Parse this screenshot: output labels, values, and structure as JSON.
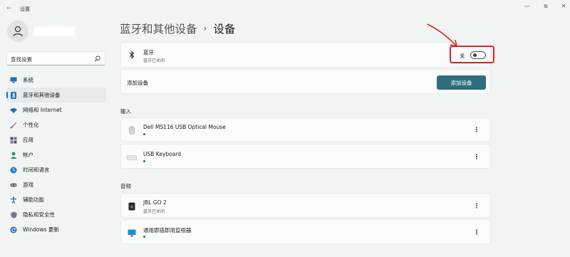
{
  "window": {
    "back_glyph": "←",
    "title": "设置",
    "minimize_glyph": "—",
    "maximize_glyph": "⧉",
    "close_glyph": "✕"
  },
  "search": {
    "value": "查找设置"
  },
  "nav": {
    "items": [
      {
        "label": "系统",
        "icon": "monitor-icon"
      },
      {
        "label": "蓝牙和其他设备",
        "icon": "bluetooth-icon",
        "active": true
      },
      {
        "label": "网络和 Internet",
        "icon": "wifi-icon"
      },
      {
        "label": "个性化",
        "icon": "brush-icon"
      },
      {
        "label": "应用",
        "icon": "apps-icon"
      },
      {
        "label": "帐户",
        "icon": "person-icon"
      },
      {
        "label": "时间和语言",
        "icon": "globe-clock-icon"
      },
      {
        "label": "游戏",
        "icon": "gamepad-icon"
      },
      {
        "label": "辅助功能",
        "icon": "accessibility-icon"
      },
      {
        "label": "隐私和安全性",
        "icon": "shield-icon"
      },
      {
        "label": "Windows 更新",
        "icon": "update-icon"
      }
    ]
  },
  "breadcrumb": {
    "parent": "蓝牙和其他设备",
    "separator": "›",
    "current": "设备"
  },
  "bluetooth": {
    "title": "蓝牙",
    "subtitle": "蓝牙已关闭",
    "toggle_label": "关",
    "enabled": false
  },
  "add_device": {
    "title": "添加设备",
    "button": "添加设备"
  },
  "input_section": {
    "label": "输入",
    "devices": [
      {
        "name": "Dell MS116 USB Optical Mouse",
        "icon": "mouse-icon",
        "connected": true
      },
      {
        "name": "USB Keyboard",
        "icon": "keyboard-icon",
        "connected": true
      }
    ]
  },
  "audio_section": {
    "label": "音频",
    "devices": [
      {
        "name": "JBL GO 2",
        "subtitle": "蓝牙已关闭",
        "icon": "speaker-icon"
      },
      {
        "name": "通用即插即用监视器",
        "icon": "monitor-icon",
        "connected": true
      }
    ]
  },
  "more_glyph": "⋮",
  "colors": {
    "accent": "#2e6e7e",
    "highlight": "#e02020",
    "connected": "#1a8b2a",
    "active_indicator": "#1a6fb5"
  }
}
